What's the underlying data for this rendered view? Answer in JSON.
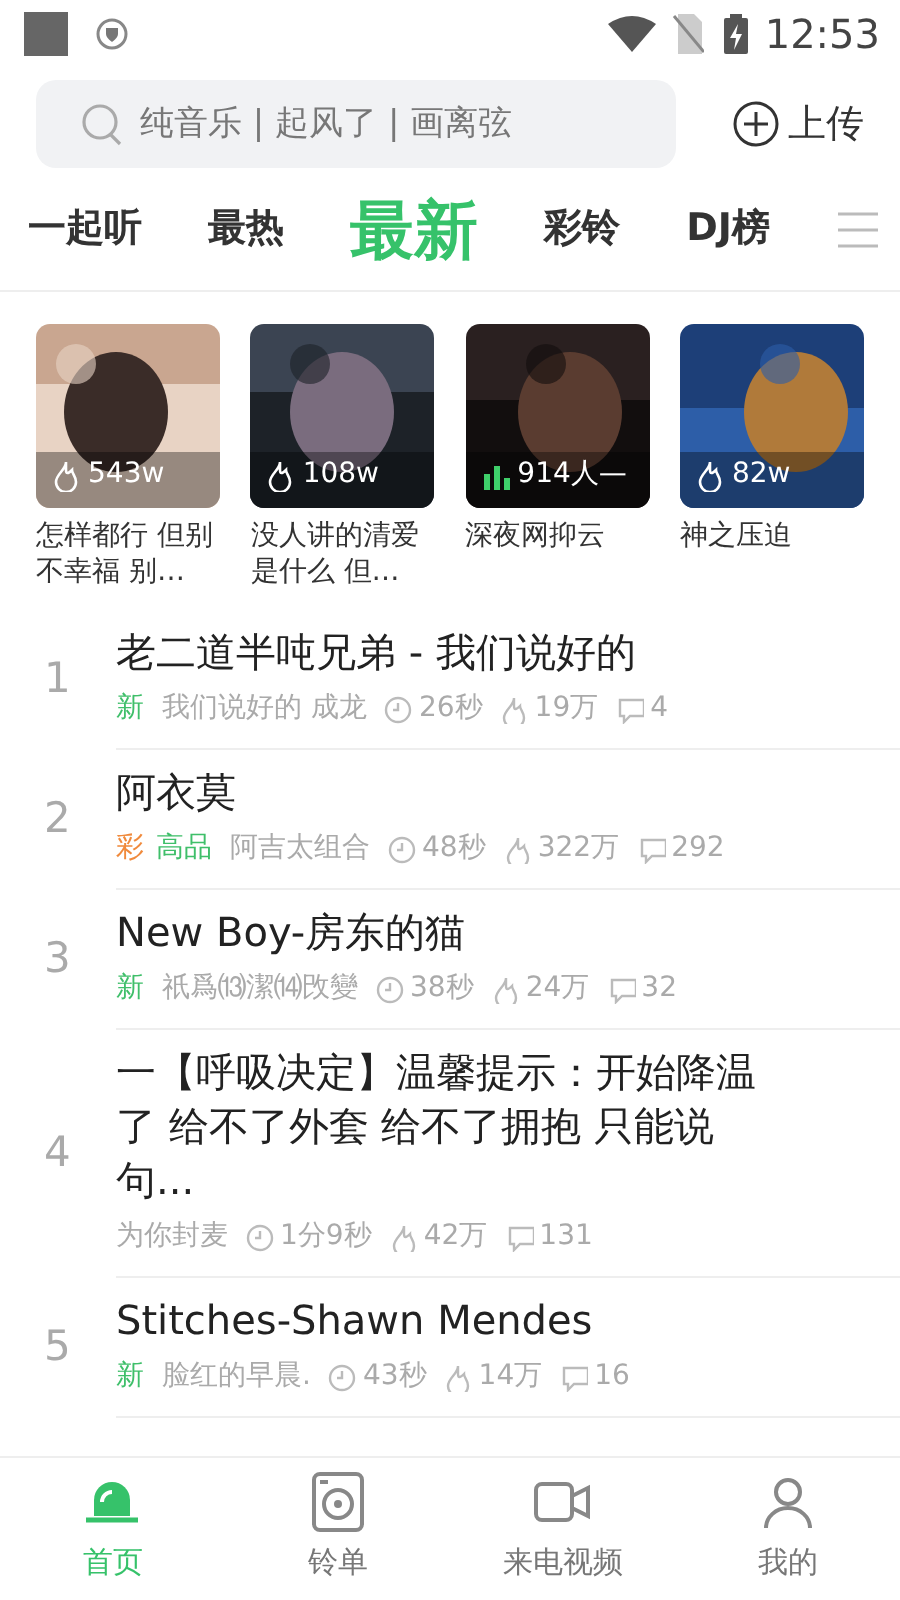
{
  "status_bar": {
    "time": "12:53"
  },
  "search": {
    "placeholder": "纯音乐 | 起风了 | 画离弦"
  },
  "upload_button": {
    "label": "上传"
  },
  "tabs": [
    {
      "label": "一起听",
      "selected": false
    },
    {
      "label": "最热",
      "selected": false
    },
    {
      "label": "最新",
      "selected": true
    },
    {
      "label": "彩铃",
      "selected": false
    },
    {
      "label": "DJ榜",
      "selected": false
    }
  ],
  "featured": [
    {
      "stat": {
        "kind": "hot",
        "text": "543w"
      },
      "title": "怎样都行 但别不幸福 别…"
    },
    {
      "stat": {
        "kind": "hot",
        "text": "108w"
      },
      "title": "没人讲的清爱是什么 但…"
    },
    {
      "stat": {
        "kind": "live",
        "text": "914人—"
      },
      "title": "深夜网抑云"
    },
    {
      "stat": {
        "kind": "hot",
        "text": "82w"
      },
      "title": "神之压迫"
    }
  ],
  "songs": [
    {
      "rank": "1",
      "title": "老二道半吨兄弟 - 我们说好的",
      "tags": [
        {
          "text": "新",
          "color": "#3fbf6a"
        }
      ],
      "artist": "我们说好的 成龙",
      "duration": "26秒",
      "plays": "19万",
      "comments": "4"
    },
    {
      "rank": "2",
      "title": "阿衣莫",
      "tags": [
        {
          "text": "彩",
          "color": "#f08a3c"
        },
        {
          "text": "高品",
          "color": "#3fbf6a"
        }
      ],
      "artist": "阿吉太组合",
      "duration": "48秒",
      "plays": "322万",
      "comments": "292"
    },
    {
      "rank": "3",
      "title": "New Boy-房东的猫",
      "tags": [
        {
          "text": "新",
          "color": "#3fbf6a"
        }
      ],
      "artist": "祇爲⒀潔⒁攺變",
      "duration": "38秒",
      "plays": "24万",
      "comments": "32"
    },
    {
      "rank": "4",
      "title": "一【呼吸决定】温馨提示：开始降温了 给不了外套 给不了拥抱 只能说句...",
      "artist": "为你封麦",
      "duration": "1分9秒",
      "plays": "42万",
      "comments": "131"
    },
    {
      "rank": "5",
      "title": "Stitches-Shawn Mendes",
      "tags": [
        {
          "text": "新",
          "color": "#3fbf6a"
        }
      ],
      "artist": "脸红的早晨.",
      "duration": "43秒",
      "plays": "14万",
      "comments": "16"
    }
  ],
  "bottom_nav": [
    {
      "kind": "home",
      "label": "首页",
      "selected": true
    },
    {
      "kind": "list",
      "label": "铃单",
      "selected": false
    },
    {
      "kind": "video",
      "label": "来电视频",
      "selected": false
    },
    {
      "kind": "me",
      "label": "我的",
      "selected": false
    }
  ]
}
